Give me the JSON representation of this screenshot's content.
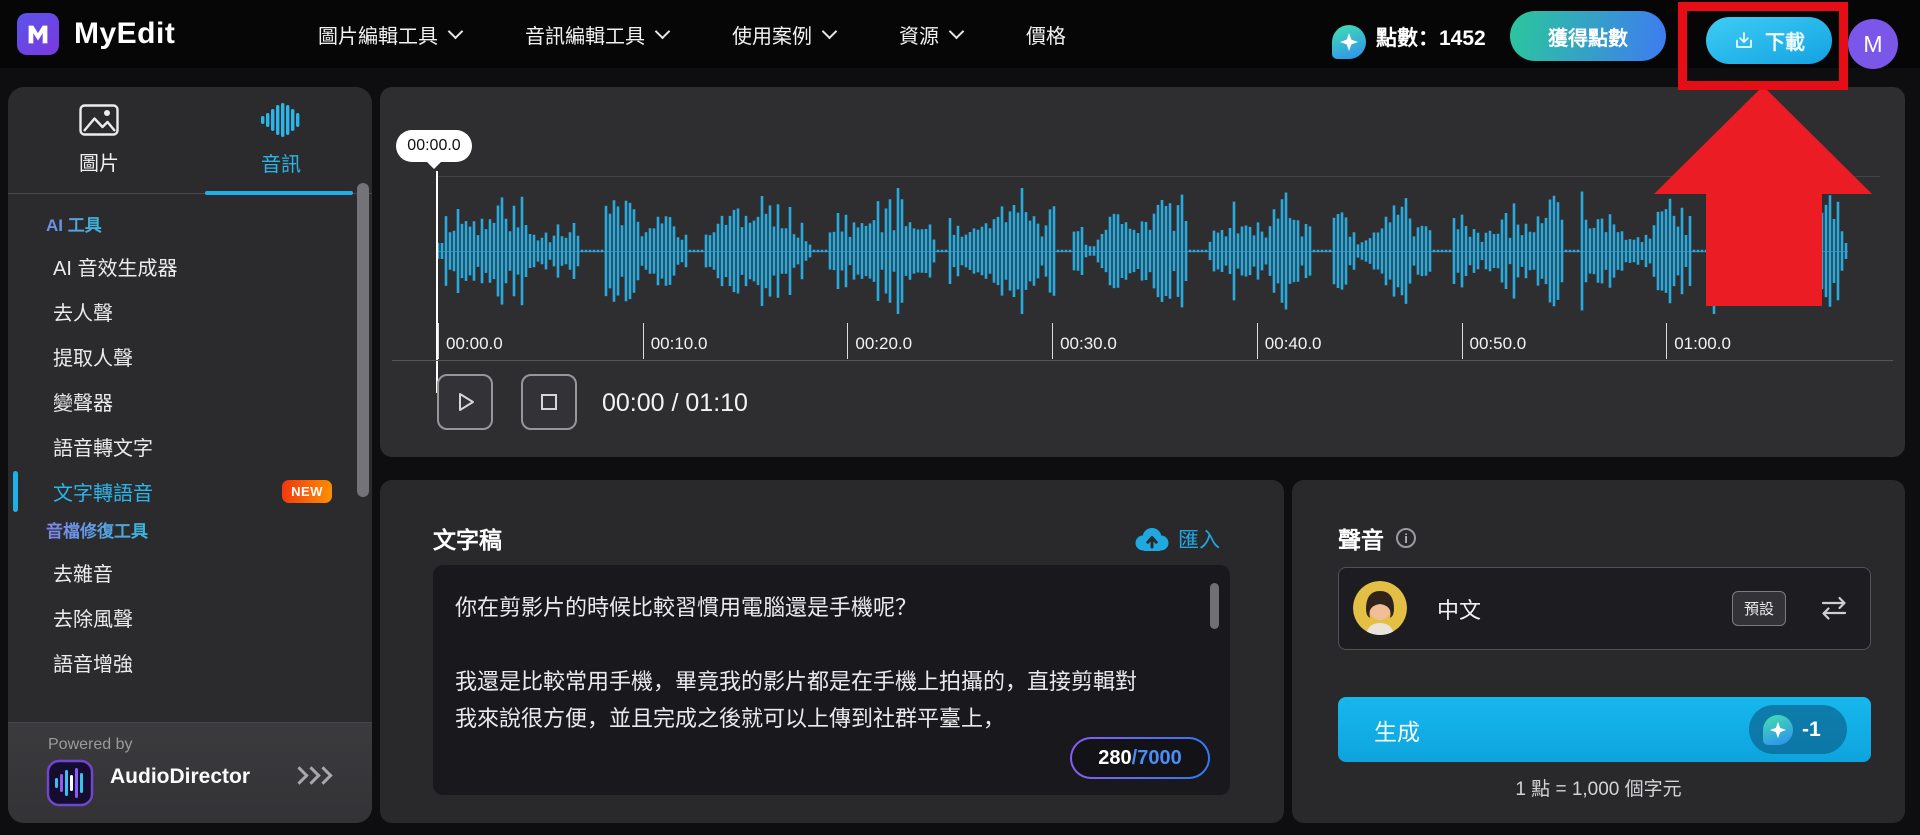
{
  "header": {
    "brand": "MyEdit",
    "nav_items": [
      {
        "label": "圖片編輯工具",
        "dropdown": true
      },
      {
        "label": "音訊編輯工具",
        "dropdown": true
      },
      {
        "label": "使用案例",
        "dropdown": true
      },
      {
        "label": "資源",
        "dropdown": true
      },
      {
        "label": "價格",
        "dropdown": false
      }
    ],
    "points_label": "點數：1452",
    "get_points_button": "獲得點數",
    "download_button": "下載",
    "avatar_initial": "M"
  },
  "sidebar": {
    "tabs": [
      {
        "label": "圖片",
        "active": false
      },
      {
        "label": "音訊",
        "active": true
      }
    ],
    "sections": [
      {
        "header": "AI 工具",
        "items": [
          {
            "label": "AI 音效生成器"
          },
          {
            "label": "去人聲"
          },
          {
            "label": "提取人聲"
          },
          {
            "label": "變聲器"
          },
          {
            "label": "語音轉文字"
          },
          {
            "label": "文字轉語音",
            "active": true,
            "badge": "NEW"
          }
        ]
      },
      {
        "header": "音檔修復工具",
        "items": [
          {
            "label": "去雜音"
          },
          {
            "label": "去除風聲"
          },
          {
            "label": "語音增強"
          }
        ]
      }
    ],
    "footer": {
      "powered_by": "Powered by",
      "product": "AudioDirector"
    }
  },
  "player": {
    "playhead_tooltip": "00:00.0",
    "ticks": [
      "00:00.0",
      "00:10.0",
      "00:20.0",
      "00:30.0",
      "00:40.0",
      "00:50.0",
      "01:00.0"
    ],
    "time_display": "00:00 / 01:10"
  },
  "transcript": {
    "title": "文字稿",
    "import_label": "匯入",
    "lines": [
      "你在剪影片的時候比較習慣用電腦還是手機呢？",
      "",
      "我還是比較常用手機，畢竟我的影片都是在手機上拍攝的，直接剪輯對",
      "我來說很方便，並且完成之後就可以上傳到社群平臺上，"
    ],
    "char_count": "280",
    "char_limit": "/7000"
  },
  "voice": {
    "title": "聲音",
    "language": "中文",
    "default_badge": "預設",
    "generate_button": "生成",
    "cost_badge": "-1",
    "pricing_note": "1 點 = 1,000 個字元"
  },
  "colors": {
    "accent_cyan": "#1FB0E8",
    "highlight_red": "#E50E16",
    "panel": "#2B2B2E"
  }
}
